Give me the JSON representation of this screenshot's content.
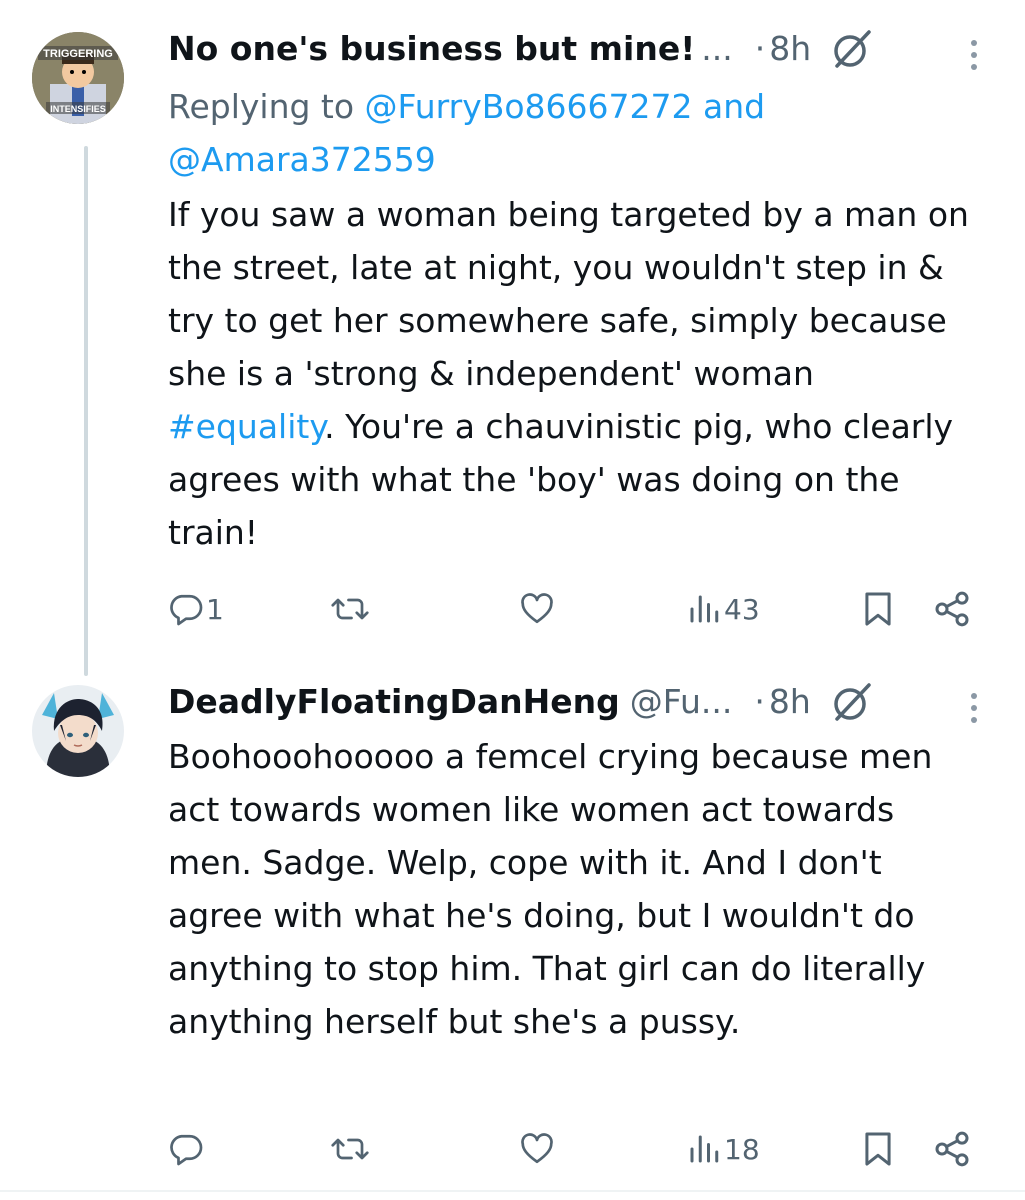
{
  "tweets": [
    {
      "display_name": "No one's business but mine!",
      "handle": "",
      "ellipsis": "...",
      "separator": "·",
      "time": "8h",
      "avatar": {
        "top_text": "TRIGGERING",
        "bottom_text": "INTENSIFIES",
        "icon": "cartoon-avatar"
      },
      "reply_prefix": "Replying to ",
      "reply_user_1": "@FurryBo86667272",
      "reply_and": " and",
      "reply_user_2": "@Amara372559",
      "text_before_tag": "If you saw a woman being targeted by a man on the street, late at night, you wouldn't step in & try to get her somewhere safe, simply because she is a 'strong & independent' woman ",
      "hashtag": "#equality",
      "text_after_tag": ". You're a chauvinistic pig, who clearly agrees with what the 'boy' was doing on the train!",
      "actions": {
        "replies": "1",
        "reposts": "",
        "likes": "",
        "views": "43"
      }
    },
    {
      "display_name": "DeadlyFloatingDanHeng",
      "handle": "@Fu...",
      "ellipsis": "",
      "separator": "·",
      "time": "8h",
      "avatar": {
        "icon": "anime-character-avatar"
      },
      "text": "Boohooohooooo a femcel crying because men act towards women like women act towards men. Sadge. Welp, cope with it. And I don't agree with what he's doing, but I wouldn't do anything to stop him. That girl can do literally anything herself but she's a pussy.",
      "actions": {
        "replies": "",
        "reposts": "",
        "likes": "",
        "views": "18"
      }
    }
  ],
  "colors": {
    "text": "#0f1419",
    "secondary": "#536471",
    "link": "#1d9bf0",
    "thread_line": "#cfd9de"
  },
  "icons": [
    "reply-icon",
    "repost-icon",
    "like-icon",
    "views-icon",
    "bookmark-icon",
    "share-icon",
    "grok-icon",
    "more-icon"
  ]
}
